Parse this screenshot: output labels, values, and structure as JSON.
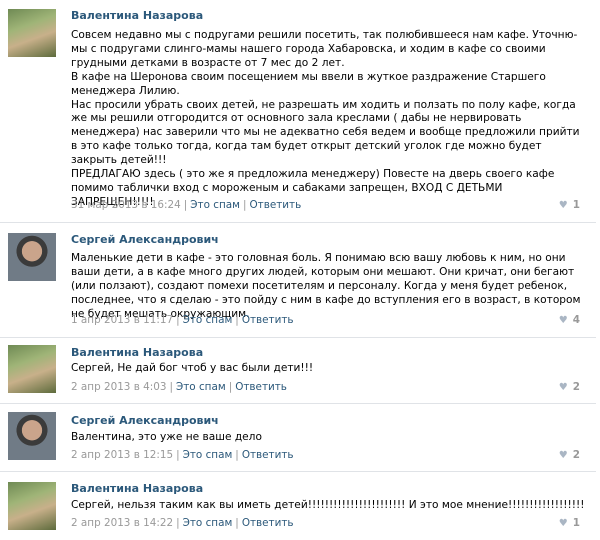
{
  "comments": [
    {
      "author": "Валентина Назарова",
      "text": "Совсем недавно мы с подругами решили посетить, так полюбившееся нам кафе. Уточню-мы с подругами слинго-мамы нашего города Хабаровска, и ходим в кафе со своими грудными детками в возрасте от 7 мес до 2 лет.\nВ кафе на Шеронова своим посещением мы ввели в жуткое раздражение Старшего менеджера Лилию.\nНас просили убрать своих детей, не разрешать им ходить и ползать по полу кафе, когда же мы решили отгородится от основного зала креслами ( дабы не нервировать менеджера) нас заверили что мы не адекватно себя ведем и вообще предложили прийти в это кафе только тогда, когда там будет открыт детский уголок где можно будет закрыть детей!!!\nПРЕДЛАГАЮ здесь ( это же я предложила менеджеру) Повесте на дверь своего кафе помимо таблички вход с мороженым и сабаками запрещен, ВХОД С ДЕТЬМИ ЗАПРЕЩЕН!!!!!",
      "date": "31 мар 2013 в 16:24",
      "spam": "Это спам",
      "reply": "Ответить",
      "likes": "1"
    },
    {
      "author": "Сергей Александрович",
      "text": "Маленькие дети в кафе - это головная боль. Я понимаю всю вашу любовь к ним, но они ваши дети, а в кафе много других людей, которым они мешают. Они кричат, они бегают (или ползают), создают помехи посетителям и персоналу. Когда у меня будет ребенок, последнее, что я сделаю - это пойду с ним в кафе до вступления его в возраст, в котором не будет мешать окружающим.",
      "date": "1 апр 2013 в 11:17",
      "spam": "Это спам",
      "reply": "Ответить",
      "likes": "4"
    },
    {
      "author": "Валентина Назарова",
      "text": "Сергей, Не дай бог чтоб у вас были дети!!!",
      "date": "2 апр 2013 в 4:03",
      "spam": "Это спам",
      "reply": "Ответить",
      "likes": "2"
    },
    {
      "author": "Сергей Александрович",
      "text": "Валентина, это уже не ваше дело",
      "date": "2 апр 2013 в 12:15",
      "spam": "Это спам",
      "reply": "Ответить",
      "likes": "2"
    },
    {
      "author": "Валентина Назарова",
      "text": "Сергей, нельзя таким как вы иметь детей!!!!!!!!!!!!!!!!!!!!!!! И это мое мнение!!!!!!!!!!!!!!!!!!",
      "date": "2 апр 2013 в 14:22",
      "spam": "Это спам",
      "reply": "Ответить",
      "likes": "1"
    }
  ]
}
